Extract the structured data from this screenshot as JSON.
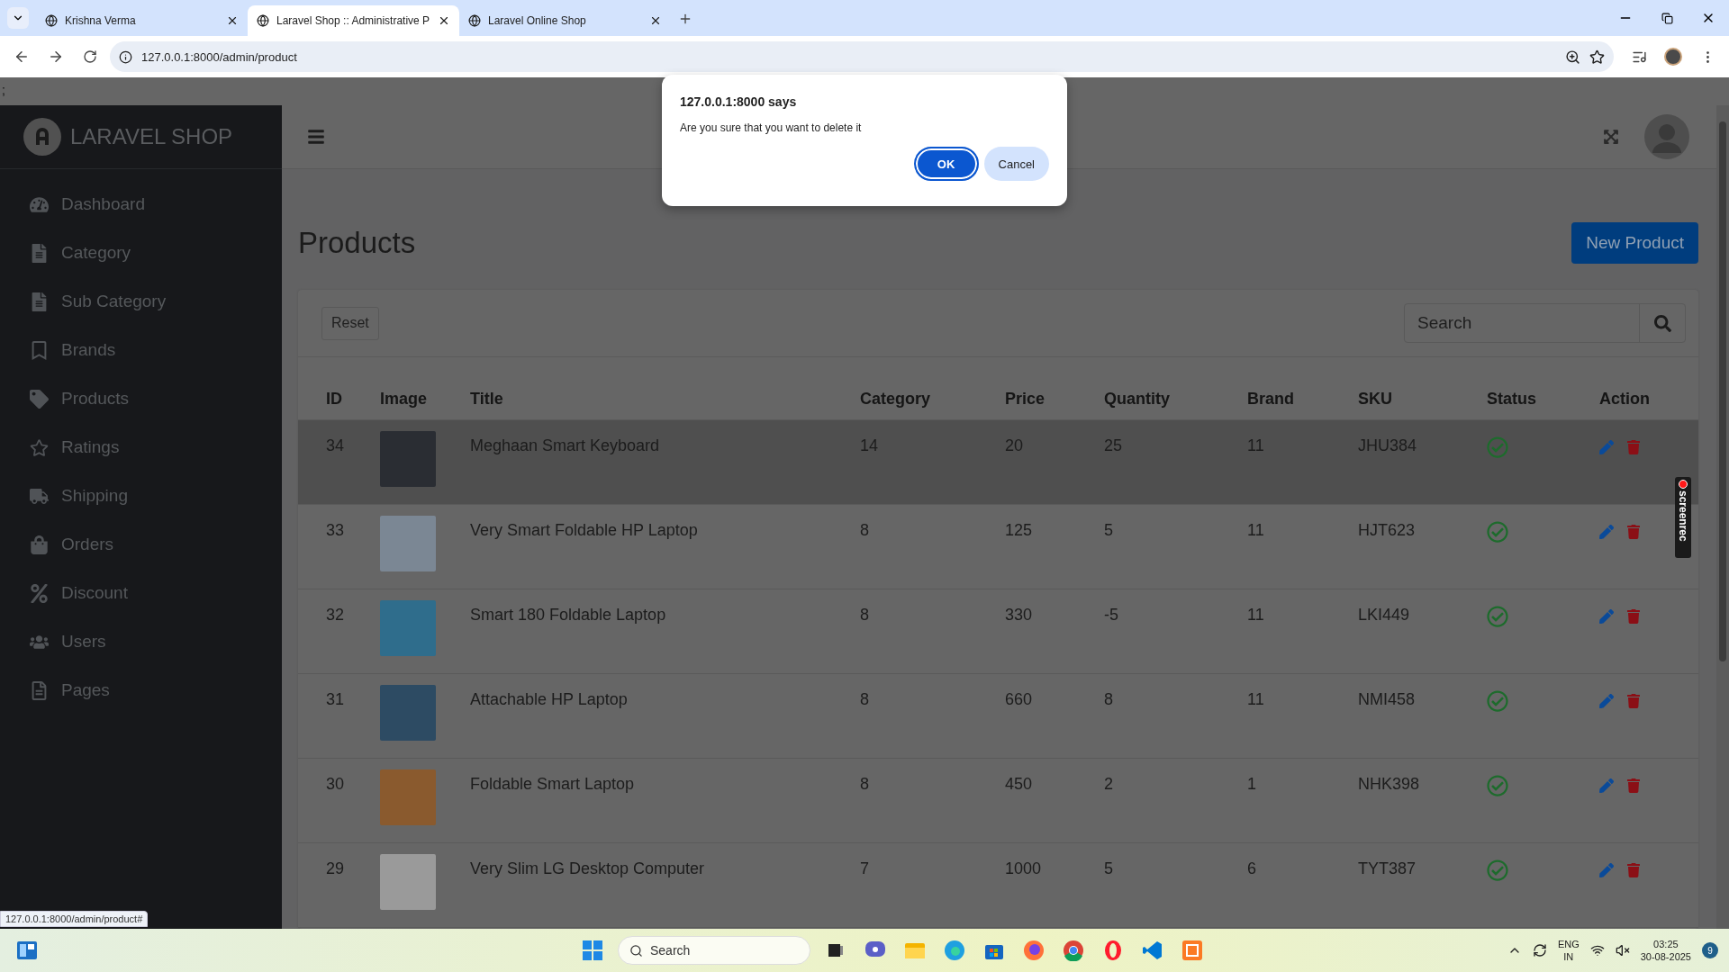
{
  "browser": {
    "tabs": [
      {
        "title": "Krishna Verma",
        "selected": false
      },
      {
        "title": "Laravel Shop :: Administrative P",
        "selected": true
      },
      {
        "title": "Laravel Online Shop",
        "selected": false
      }
    ],
    "url": "127.0.0.1:8000/admin/product"
  },
  "page": {
    "stray_text": ";",
    "sidebar": {
      "brand": "LARAVEL SHOP",
      "items": [
        {
          "label": "Dashboard"
        },
        {
          "label": "Category"
        },
        {
          "label": "Sub Category"
        },
        {
          "label": "Brands"
        },
        {
          "label": "Products"
        },
        {
          "label": "Ratings"
        },
        {
          "label": "Shipping"
        },
        {
          "label": "Orders"
        },
        {
          "label": "Discount"
        },
        {
          "label": "Users"
        },
        {
          "label": "Pages"
        }
      ]
    },
    "title": "Products",
    "new_button": "New Product",
    "reset_button": "Reset",
    "search": {
      "placeholder": "Search"
    },
    "table": {
      "columns": [
        "ID",
        "Image",
        "Title",
        "Category",
        "Price",
        "Quantity",
        "Brand",
        "SKU",
        "Status",
        "Action"
      ],
      "rows": [
        {
          "id": "34",
          "title": "Meghaan Smart Keyboard",
          "category": "14",
          "price": "20",
          "quantity": "25",
          "brand": "11",
          "sku": "JHU384",
          "active": true,
          "highlighted": true
        },
        {
          "id": "33",
          "title": "Very Smart Foldable HP Laptop",
          "category": "8",
          "price": "125",
          "quantity": "5",
          "brand": "11",
          "sku": "HJT623",
          "active": true,
          "highlighted": false
        },
        {
          "id": "32",
          "title": "Smart 180 Foldable Laptop",
          "category": "8",
          "price": "330",
          "quantity": "-5",
          "brand": "11",
          "sku": "LKI449",
          "active": true,
          "highlighted": false
        },
        {
          "id": "31",
          "title": "Attachable HP Laptop",
          "category": "8",
          "price": "660",
          "quantity": "8",
          "brand": "11",
          "sku": "NMI458",
          "active": true,
          "highlighted": false
        },
        {
          "id": "30",
          "title": "Foldable Smart Laptop",
          "category": "8",
          "price": "450",
          "quantity": "2",
          "brand": "1",
          "sku": "NHK398",
          "active": true,
          "highlighted": false
        },
        {
          "id": "29",
          "title": "Very Slim LG Desktop Computer",
          "category": "7",
          "price": "1000",
          "quantity": "5",
          "brand": "6",
          "sku": "TYT387",
          "active": true,
          "highlighted": false
        }
      ]
    },
    "status_link": "127.0.0.1:8000/admin/product#",
    "recorder_label": "screenrec"
  },
  "dialog": {
    "title": "127.0.0.1:8000 says",
    "message": "Are you sure that you want to delete it",
    "buttons": [
      {
        "label": "OK",
        "primary": true
      },
      {
        "label": "Cancel",
        "primary": false
      }
    ]
  },
  "taskbar": {
    "search_placeholder": "Search",
    "language": "ENG",
    "region": "IN",
    "time": "03:25",
    "date": "30-08-2025",
    "notifications": "9"
  }
}
